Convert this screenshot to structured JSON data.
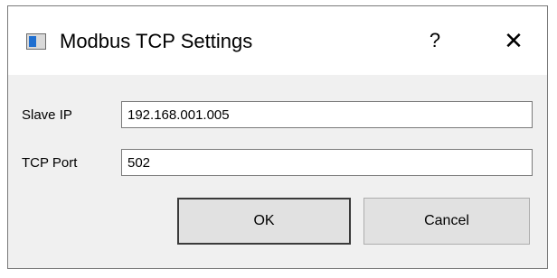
{
  "window": {
    "title": "Modbus TCP Settings",
    "help_glyph": "?",
    "close_glyph": "✕",
    "app_icon": "window-icon"
  },
  "form": {
    "slave_ip_label": "Slave IP",
    "slave_ip_value": "192.168.001.005",
    "tcp_port_label": "TCP Port",
    "tcp_port_value": "502"
  },
  "buttons": {
    "ok_label": "OK",
    "cancel_label": "Cancel"
  },
  "colors": {
    "titlebar_bg": "#ffffff",
    "dialog_bg": "#f0f0f0",
    "button_bg": "#e1e1e1",
    "icon_accent": "#1f6fd0"
  }
}
